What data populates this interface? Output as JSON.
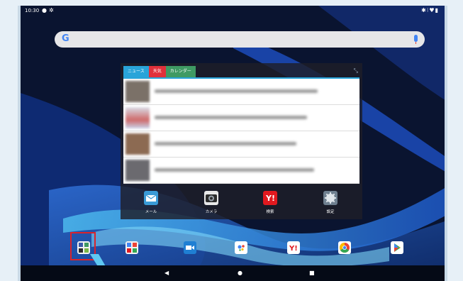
{
  "status_bar": {
    "time": "10:30",
    "left_icons": [
      "notification-icon",
      "settings-icon"
    ],
    "right_icons": [
      "bluetooth-icon",
      "vibrate-icon",
      "wifi-icon",
      "battery-icon"
    ]
  },
  "search_bar": {
    "logo": "G",
    "logo_color": "#4285f4",
    "mic_icon": "microphone-icon"
  },
  "news_widget": {
    "tabs": [
      {
        "label": "ニュース",
        "color": "#29a4d9"
      },
      {
        "label": "天気",
        "color": "#e1313b"
      },
      {
        "label": "カレンダー",
        "color": "#3f9a63"
      }
    ],
    "expand_icon": "expand-icon",
    "thumb_colors": [
      "#7b7168",
      "#cfd5e6",
      "#8c6a52",
      "#6b6a6f"
    ],
    "app_shortcuts": [
      {
        "label": "メール",
        "icon": "mail-icon",
        "color": "#3a9bd7"
      },
      {
        "label": "カメラ",
        "icon": "camera-icon",
        "color": "#e8e8e8"
      },
      {
        "label": "検索",
        "icon": "yahoo-search-icon",
        "color": "#e1191f"
      },
      {
        "label": "設定",
        "icon": "settings-icon",
        "color": "#6e7f8f"
      }
    ]
  },
  "dock": {
    "apps": [
      {
        "icon": "app-drawer-icon",
        "color": "#f2f2f2"
      },
      {
        "icon": "google-apps-folder-icon",
        "color": "#f2f2f2"
      },
      {
        "icon": "video-camera-icon",
        "color": "#1f7fd3"
      },
      {
        "icon": "google-assistant-icon",
        "color": "#ffffff"
      },
      {
        "icon": "yahoo-japan-icon",
        "color": "#ffffff"
      },
      {
        "icon": "chrome-icon",
        "color": "#ffffff"
      },
      {
        "icon": "play-store-icon",
        "color": "#ffffff"
      }
    ],
    "highlighted_index": 0,
    "highlight_color": "#d9232b"
  },
  "nav_bar": {
    "buttons": [
      "back-icon",
      "home-icon",
      "recents-icon"
    ]
  }
}
